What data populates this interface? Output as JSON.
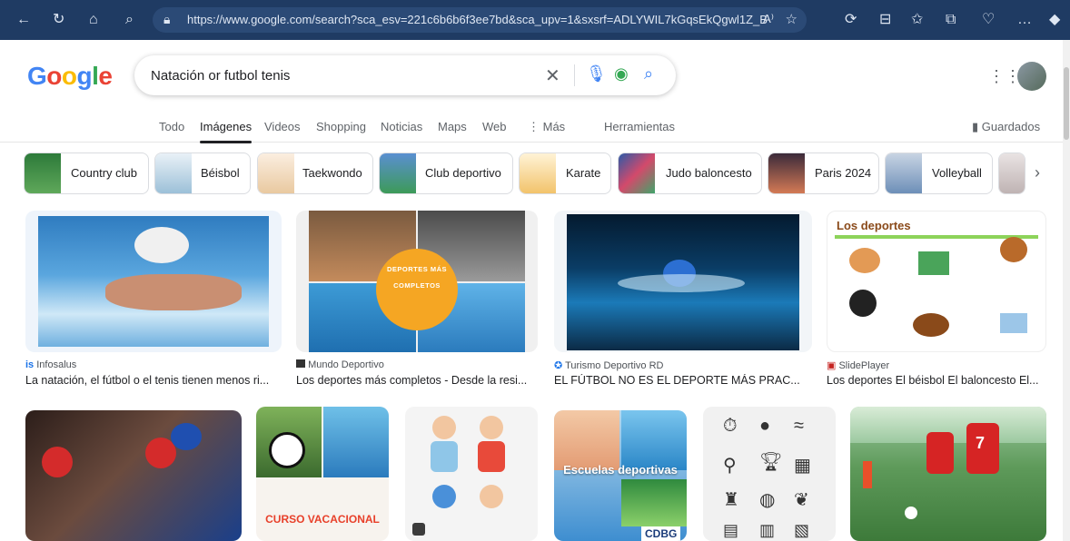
{
  "browser": {
    "url": "https://www.google.com/search?sca_esv=221c6b6b6f3ee7bd&sca_upv=1&sxsrf=ADLYWIL7kGqsEkQgwl1Z_BV1lzlzr...",
    "aa": "A⁾"
  },
  "google": {
    "logo": "Google",
    "query": "Natación or futbol tenis"
  },
  "tabs": [
    "Todo",
    "Imágenes",
    "Videos",
    "Shopping",
    "Noticias",
    "Maps",
    "Web",
    "⋮ Más"
  ],
  "tools": "Herramientas",
  "saved": "Guardados",
  "chips": [
    "Country club",
    "Béisbol",
    "Taekwondo",
    "Club deportivo",
    "Karate",
    "Judo baloncesto",
    "Paris 2024",
    "Volleyball"
  ],
  "results": [
    {
      "source": "Infosalus",
      "caption": "La natación, el fútbol o el tenis tienen menos ri..."
    },
    {
      "source": "Mundo Deportivo",
      "caption": "Los deportes más completos - Desde la resi..."
    },
    {
      "source": "Turismo Deportivo RD",
      "caption": "EL FÚTBOL NO ES EL DEPORTE MÁS PRAC..."
    },
    {
      "source": "SlidePlayer",
      "caption": "Los deportes El béisbol El baloncesto El..."
    }
  ],
  "overlay_texts": {
    "deportes": "DEPORTES MÁS COMPLETOS",
    "los_deportes": "Los deportes",
    "curso": "CURSO VACACIONAL",
    "escuelas": "Escuelas deportivas",
    "cdbg": "CDBG"
  }
}
